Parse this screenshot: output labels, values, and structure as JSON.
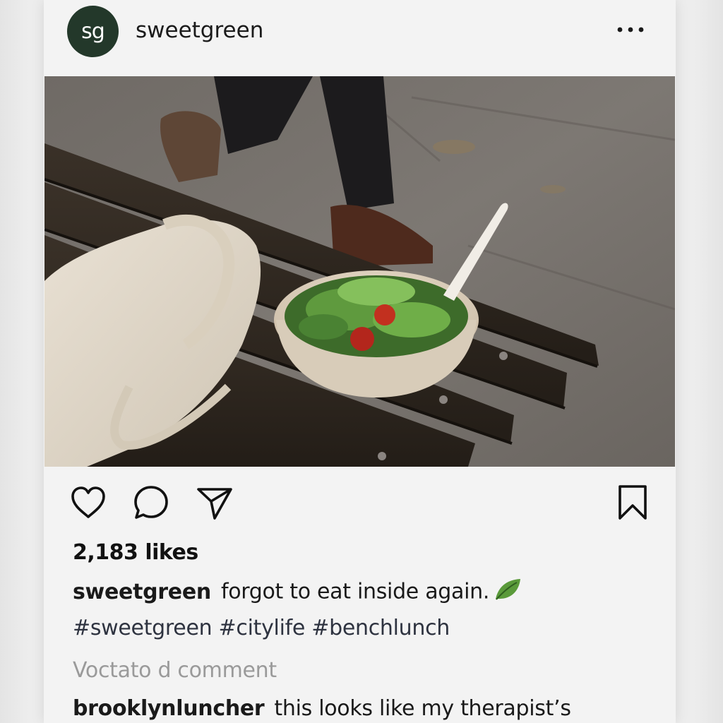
{
  "post": {
    "avatar_initials": "sg",
    "username": "sweetgreen",
    "more_icon": "more-horizontal-icon",
    "photo_alt": "Salad bowl with fork on a wooden bench next to a tote bag",
    "likes": "2,183 likes",
    "caption": {
      "author": "sweetgreen",
      "text": "forgot to eat inside again."
    },
    "hashtags": "#sweetgreen #citylife #benchlunch",
    "view_comments": "Voctato d comment",
    "comments": [
      {
        "author": "brooklynluncher",
        "text": "this looks like my therapist’s"
      }
    ]
  },
  "actions": {
    "like": "heart-icon",
    "comment": "comment-icon",
    "share": "send-icon",
    "save": "bookmark-icon"
  },
  "colors": {
    "avatar_bg": "#23382a",
    "background": "#f3f3f3",
    "text": "#1a1a1a",
    "muted": "#9a9a9a",
    "leaf": "#5a9a3a"
  }
}
